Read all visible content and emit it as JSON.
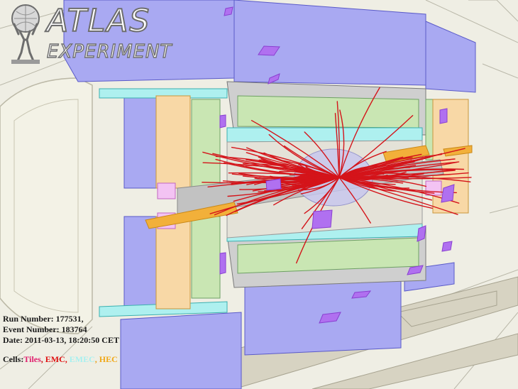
{
  "logo": {
    "title": "ATLAS",
    "subtitle": "EXPERIMENT"
  },
  "event": {
    "run_number": "Run Number: 177531,",
    "event_number": "Event Number: 183764",
    "date": "Date: 2011-03-13, 18:20:50 CET"
  },
  "legend": {
    "prefix": "Cells:",
    "items": [
      {
        "label": "Tiles",
        "color": "#e0206e"
      },
      {
        "label": ", ",
        "color": "#cc1111"
      },
      {
        "label": "EMC",
        "color": "#e01010"
      },
      {
        "label": ", ",
        "color": "#e01010"
      },
      {
        "label": "EMEC",
        "color": "#a8f0f0"
      },
      {
        "label": ", ",
        "color": "#e8a020"
      },
      {
        "label": "HEC",
        "color": "#f0a818"
      }
    ]
  },
  "colors": {
    "tile_calorimeter": "#a9a9f2",
    "em_calorimeter": "#c9e6b3",
    "emec": "#aef0ef",
    "hec": "#f8d8a6",
    "tracks": "#d4141a",
    "energy_deposit": "#b070f0",
    "background": "#efeee4"
  }
}
